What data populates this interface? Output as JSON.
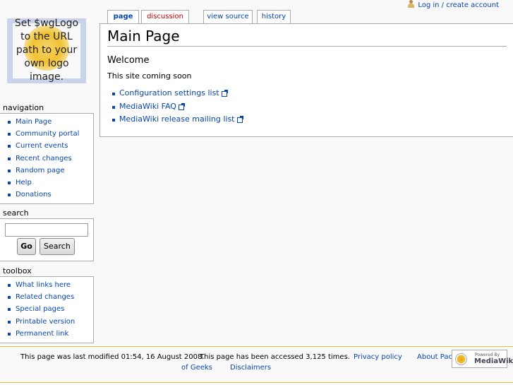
{
  "logo": {
    "text": "Set $wgLogo\nto the URL\npath to your\nown logo\nimage."
  },
  "personal_tools": {
    "login": "Log in / create account"
  },
  "tabs": [
    {
      "label": "page",
      "selected": true
    },
    {
      "label": "discussion",
      "selected": false,
      "new": true
    },
    {
      "label": "view source",
      "selected": false
    },
    {
      "label": "history",
      "selected": false
    }
  ],
  "navigation": {
    "title": "navigation",
    "items": [
      "Main Page",
      "Community portal",
      "Current events",
      "Recent changes",
      "Random page",
      "Help",
      "Donations"
    ]
  },
  "search": {
    "title": "search",
    "input_value": "",
    "go_label": "Go",
    "search_label": "Search"
  },
  "toolbox": {
    "title": "toolbox",
    "items": [
      "What links here",
      "Related changes",
      "Special pages",
      "Printable version",
      "Permanent link"
    ]
  },
  "content": {
    "heading": "Main Page",
    "subheading": "Welcome",
    "paragraph": "This site coming soon",
    "links": [
      "Configuration settings list",
      "MediaWiki FAQ",
      "MediaWiki release mailing list"
    ]
  },
  "footer": {
    "last_modified": "This page was last modified 01:54, 16 August 2008.",
    "accessed": "This page has been accessed 3,125 times.",
    "privacy": "Privacy policy",
    "about_part1": "About Pack",
    "about_part2": "of Geeks",
    "disclaimers": "Disclaimers",
    "powered_by": "Powered By",
    "mediawiki": "MediaWiki"
  },
  "colors": {
    "link": "#0645ad",
    "new_link": "#ba0000",
    "border": "#aaaaaa",
    "footer_line": "#f1c232"
  }
}
